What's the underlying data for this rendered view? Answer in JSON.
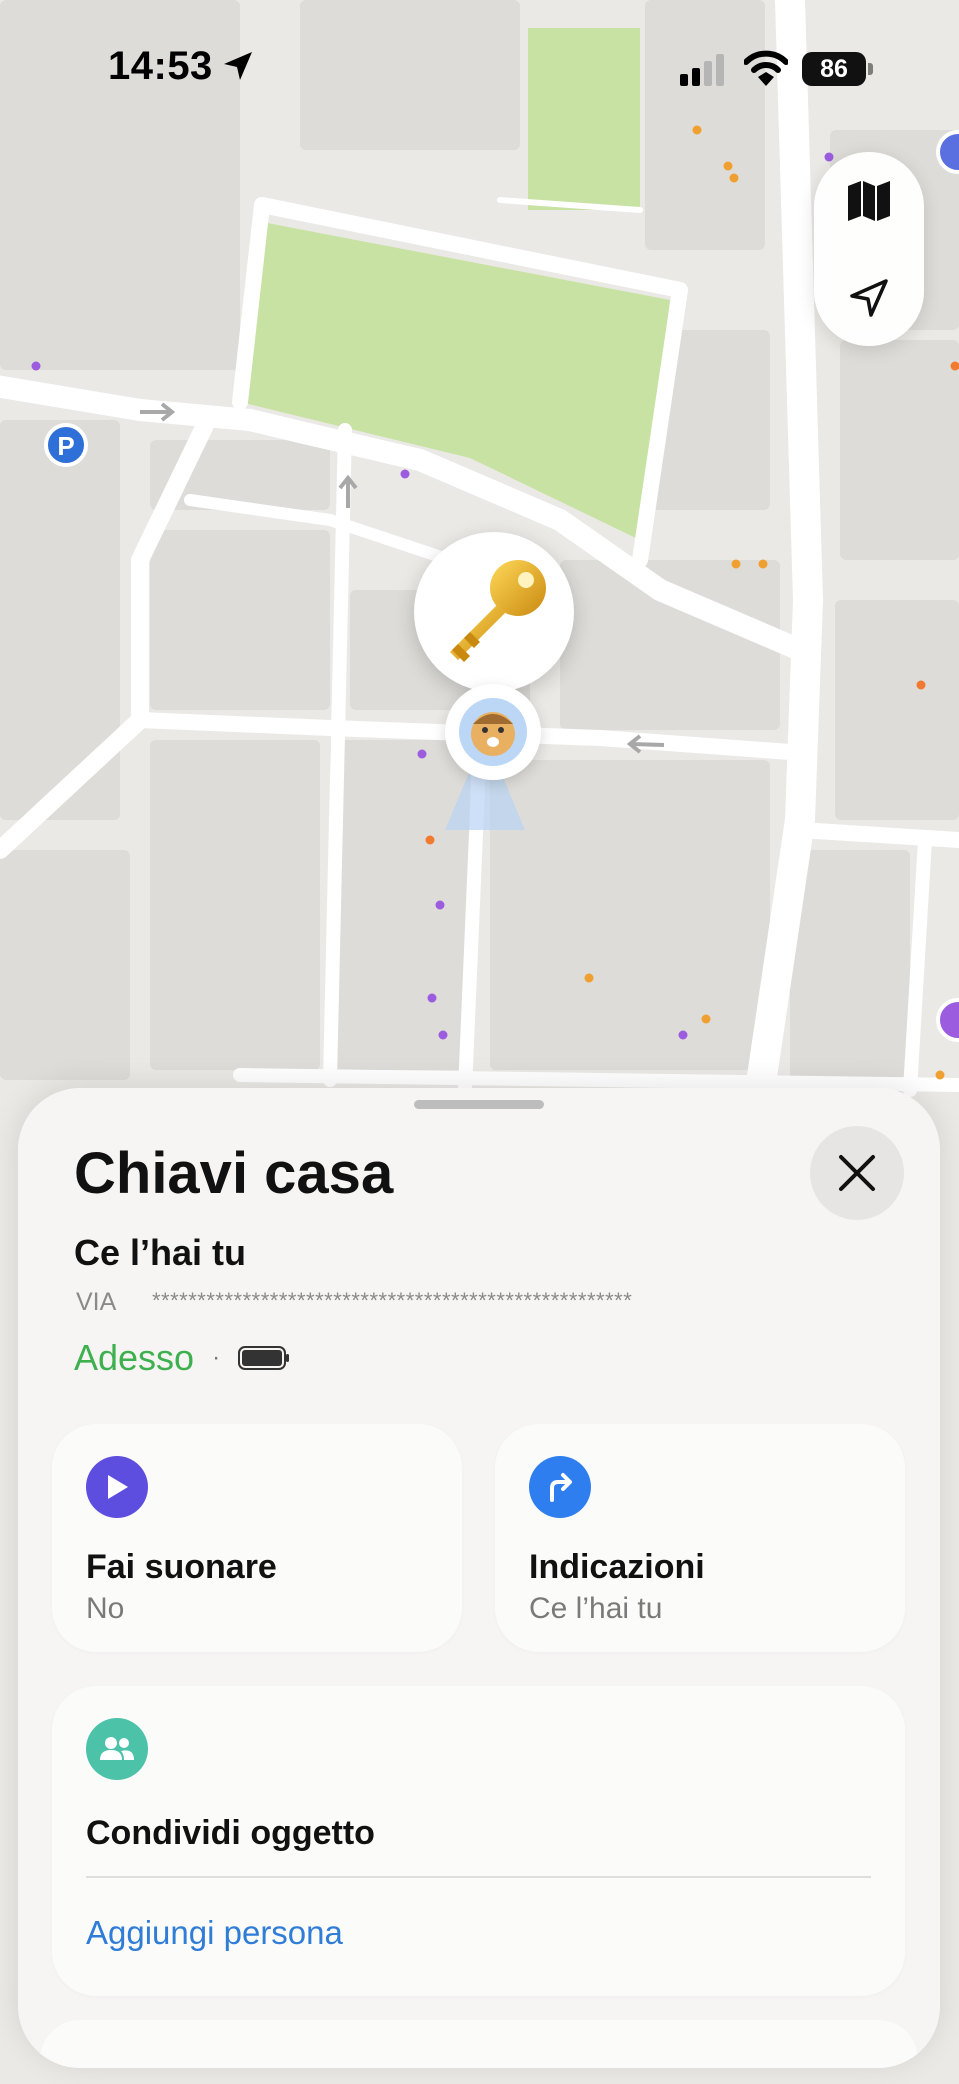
{
  "status_bar": {
    "time": "14:53",
    "battery": "86"
  },
  "map": {
    "controls": [
      {
        "name": "map-mode-icon"
      },
      {
        "name": "location-arrow-icon"
      }
    ],
    "item_pin_icon": "key-icon",
    "user_avatar_icon": "memoji-avatar-icon"
  },
  "sheet": {
    "title": "Chiavi casa",
    "status": "Ce l’hai tu",
    "address_prefix": "VIA",
    "address_masked": "*****************************************************",
    "updated": "Adesso",
    "separator": "·",
    "play_card": {
      "title": "Fai suonare",
      "subtitle": "No",
      "icon": "play-icon",
      "color": "#5e4ee0"
    },
    "directions_card": {
      "title": "Indicazioni",
      "subtitle": "Ce l’hai tu",
      "icon": "turn-right-arrow-icon",
      "color": "#2f7ef0"
    },
    "share_card": {
      "title": "Condividi oggetto",
      "link": "Aggiungi persona",
      "icon": "people-icon",
      "color": "#4cc2a9"
    }
  }
}
